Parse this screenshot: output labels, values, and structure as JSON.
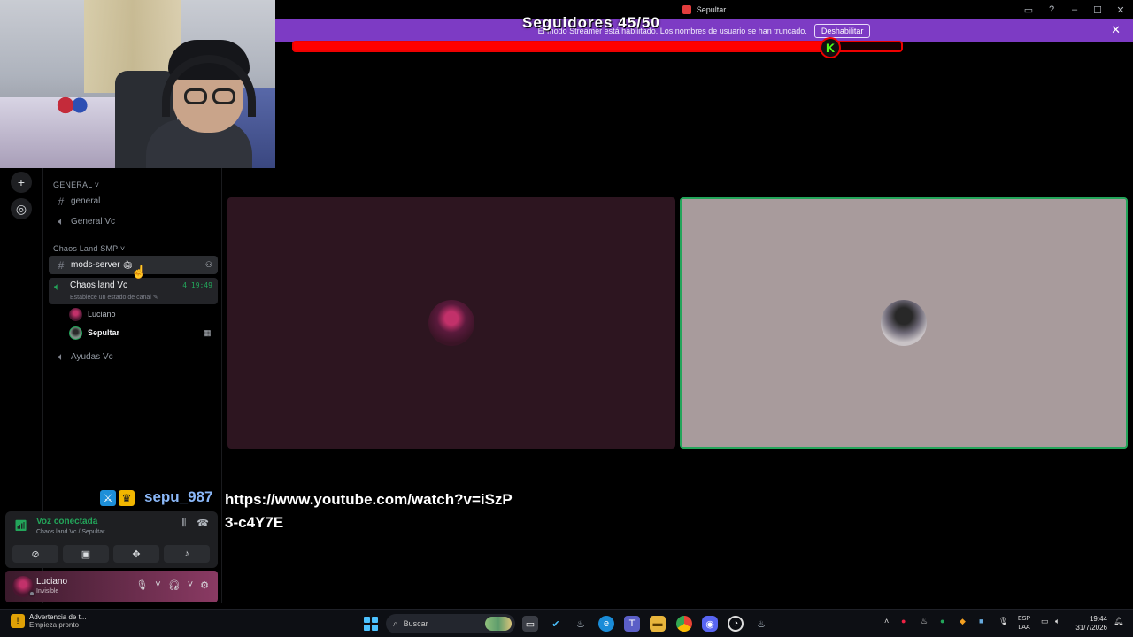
{
  "window": {
    "title": "Sepultar"
  },
  "overlay": {
    "followers_label": "Seguidores 45/50",
    "progress_fraction": 0.9,
    "kick_letter": "K"
  },
  "banner": {
    "text": "El modo Streamer está habilitado. Los nombres de usuario se han truncado.",
    "button": "Deshabilitar"
  },
  "sidebar": {
    "cat_general": "GENERAL",
    "ch_general": "general",
    "ch_general_vc": "General Vc",
    "cat_chaos": "Chaos Land SMP",
    "ch_mods": "mods-server",
    "vc_chaos": {
      "name": "Chaos land Vc",
      "time": "4:19:49",
      "status": "Establece un estado de canal"
    },
    "members": [
      "Luciano",
      "Sepultar"
    ],
    "ch_ayudas": "Ayudas Vc"
  },
  "chat": {
    "user": "sepu_987",
    "message": "https://www.youtube.com/watch?v=iSzP3-c4Y7E"
  },
  "voice": {
    "title": "Voz conectada",
    "subtitle": "Chaos land Vc / Sepultar"
  },
  "user": {
    "name": "Luciano",
    "status": "Invisible"
  },
  "taskbar": {
    "notif_title": "Advertencia de t...",
    "notif_sub": "Empieza pronto",
    "search": "Buscar",
    "lang1": "ESP",
    "lang2": "LAA",
    "time": "19:44",
    "date": "31/7/2026"
  },
  "colors": {
    "accent_green": "#23a55a",
    "banner_purple": "#7d3bc4",
    "progress_red": "#ff0000"
  }
}
